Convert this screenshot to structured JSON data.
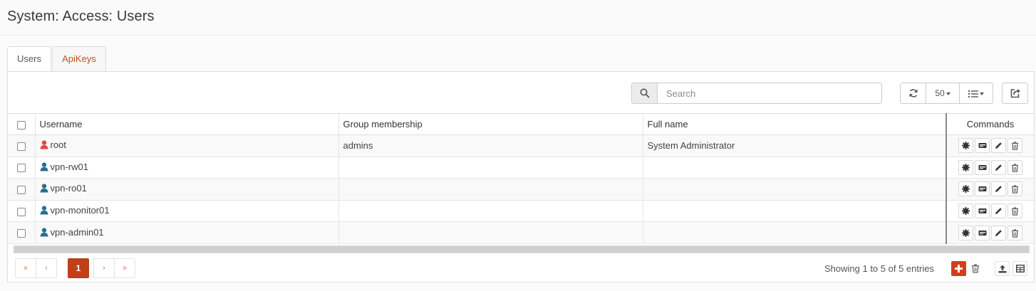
{
  "page": {
    "title": "System: Access: Users"
  },
  "tabs": [
    {
      "label": "Users",
      "active": true
    },
    {
      "label": "ApiKeys",
      "active": false
    }
  ],
  "toolbar": {
    "search_placeholder": "Search",
    "search_icon": "search-icon",
    "refresh_icon": "refresh-icon",
    "page_size": "50",
    "columns_icon": "list-icon",
    "export_icon": "share-icon"
  },
  "table": {
    "columns": [
      "Username",
      "Group membership",
      "Full name",
      "Commands"
    ],
    "rows": [
      {
        "username": "root",
        "group": "admins",
        "fullname": "System Administrator",
        "icon_color": "#e0474c"
      },
      {
        "username": "vpn-rw01",
        "group": "",
        "fullname": "",
        "icon_color": "#2c6e8f"
      },
      {
        "username": "vpn-ro01",
        "group": "",
        "fullname": "",
        "icon_color": "#2c6e8f"
      },
      {
        "username": "vpn-monitor01",
        "group": "",
        "fullname": "",
        "icon_color": "#2c6e8f"
      },
      {
        "username": "vpn-admin01",
        "group": "",
        "fullname": "",
        "icon_color": "#2c6e8f"
      }
    ],
    "command_icons": [
      "gear-icon",
      "card-icon",
      "pencil-icon",
      "trash-icon"
    ]
  },
  "pagination": {
    "first": "«",
    "prev": "‹",
    "current": "1",
    "next": "›",
    "last": "»",
    "info": "Showing 1 to 5 of 5 entries"
  },
  "colors": {
    "accent": "#c0401a",
    "link": "#c0531d"
  }
}
